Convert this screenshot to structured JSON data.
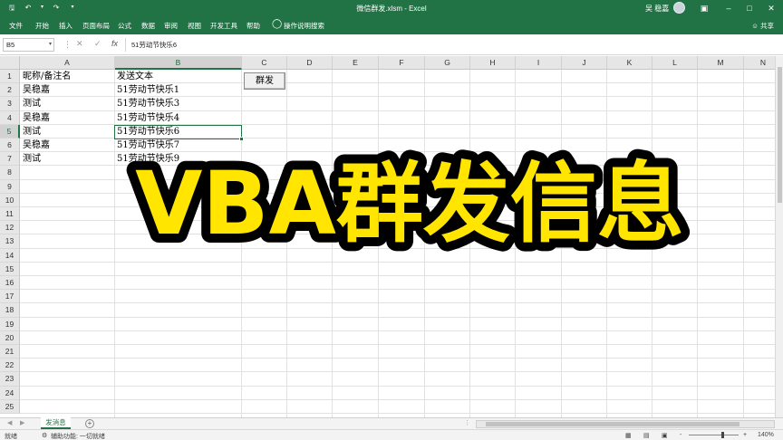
{
  "window": {
    "title": "微信群发.xlsm  -  Excel",
    "user": "吴 稳嘉",
    "minimize_icon": "minimize-icon",
    "colors": {
      "excel_green": "#217346",
      "selection_green": "#217346",
      "overlay_yellow": "#FFE500"
    }
  },
  "ribbon": {
    "tabs": [
      "文件",
      "开始",
      "插入",
      "页面布局",
      "公式",
      "数据",
      "审阅",
      "视图",
      "开发工具",
      "帮助"
    ],
    "tell_me": "操作说明搜索",
    "share": "共享"
  },
  "formula_bar": {
    "name_box": "B5",
    "cancel_icon": "✕",
    "enter_icon": "✓",
    "fx_icon": "fx",
    "content": "51劳动节快乐6"
  },
  "sheet": {
    "columns": [
      "A",
      "B",
      "C",
      "D",
      "E",
      "F",
      "G",
      "H",
      "I",
      "J",
      "K",
      "L",
      "M",
      "N"
    ],
    "selected_column": "B",
    "rows": [
      "1",
      "2",
      "3",
      "4",
      "5",
      "6",
      "7",
      "8",
      "9",
      "10",
      "11",
      "12",
      "13",
      "14",
      "15",
      "16",
      "17",
      "18",
      "19",
      "20",
      "21",
      "22",
      "23",
      "24",
      "25"
    ],
    "selected_row": "5",
    "cells": [
      [
        "昵称/备注名",
        "发送文本"
      ],
      [
        "吴稳嘉",
        "51劳动节快乐1"
      ],
      [
        "测试",
        "51劳动节快乐3"
      ],
      [
        "吴稳嘉",
        "51劳动节快乐4"
      ],
      [
        "测试",
        "51劳动节快乐6"
      ],
      [
        "吴稳嘉",
        "51劳动节快乐7"
      ],
      [
        "测试",
        "51劳动节快乐9"
      ]
    ],
    "button_label": "群发"
  },
  "overlay_text": "VBA群发信息",
  "sheet_tabs": {
    "active": "发消息",
    "add_icon": "+"
  },
  "status_bar": {
    "ready": "就绪",
    "accessibility": "辅助功能: 一切就绪",
    "zoom": "140%",
    "zoom_minus": "-",
    "zoom_plus": "+"
  }
}
